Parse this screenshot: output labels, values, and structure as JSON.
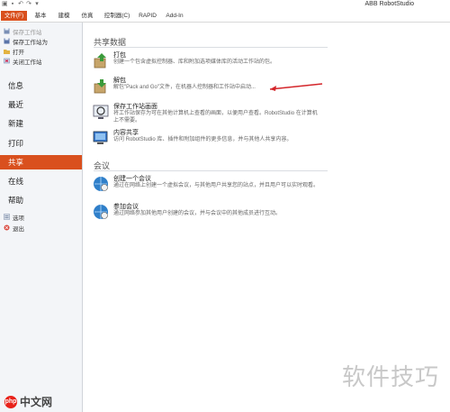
{
  "window": {
    "app_title": "ABB RobotStudio"
  },
  "tabs": [
    {
      "label": "文件(F)"
    },
    {
      "label": "基本"
    },
    {
      "label": "建模"
    },
    {
      "label": "仿真"
    },
    {
      "label": "控制器(C)"
    },
    {
      "label": "RAPID"
    },
    {
      "label": "Add-In"
    }
  ],
  "nav": {
    "small_top": [
      {
        "label": "保存工作站"
      },
      {
        "label": "保存工作站为"
      },
      {
        "label": "打开"
      },
      {
        "label": "关闭工作站"
      }
    ],
    "big": [
      {
        "label": "信息"
      },
      {
        "label": "最近"
      },
      {
        "label": "新建"
      },
      {
        "label": "打印"
      },
      {
        "label": "共享"
      },
      {
        "label": "在线"
      },
      {
        "label": "帮助"
      }
    ],
    "small_bottom": [
      {
        "label": "选项"
      },
      {
        "label": "退出"
      }
    ]
  },
  "share": {
    "heading": "共享数据",
    "items": [
      {
        "title": "打包",
        "desc": "创建一个包含虚拟控制器、库和附加选项媒体库的活动工作站的包。"
      },
      {
        "title": "解包",
        "desc": "解包\"Pack and Go\"文件，在机器人控制器和工作站中启动..."
      },
      {
        "title": "保存工作站画面",
        "desc": "将工作站保存为可在其他计算机上查看的画面，以便用户查看。RobotStudio 在计算机上不需要。"
      },
      {
        "title": "内容共享",
        "desc": "访问 RobotStudio 库、插件和附加组件的更多信息，并与其他人共享内容。"
      }
    ]
  },
  "meeting": {
    "heading": "会议",
    "items": [
      {
        "title": "创建一个会议",
        "desc": "通过在网络上创建一个虚拟会议，与其他用户共享您的站点，并且用户可以实时观看。"
      },
      {
        "title": "参加会议",
        "desc": "通过网络参加其他用户创建的会议，并与会议中的其他成员进行互动。"
      }
    ]
  },
  "watermark": "软件技巧",
  "logo": {
    "badge": "php",
    "text": "中文网"
  },
  "colors": {
    "accent": "#d9501e",
    "nav_bg": "#f3f5f8"
  }
}
